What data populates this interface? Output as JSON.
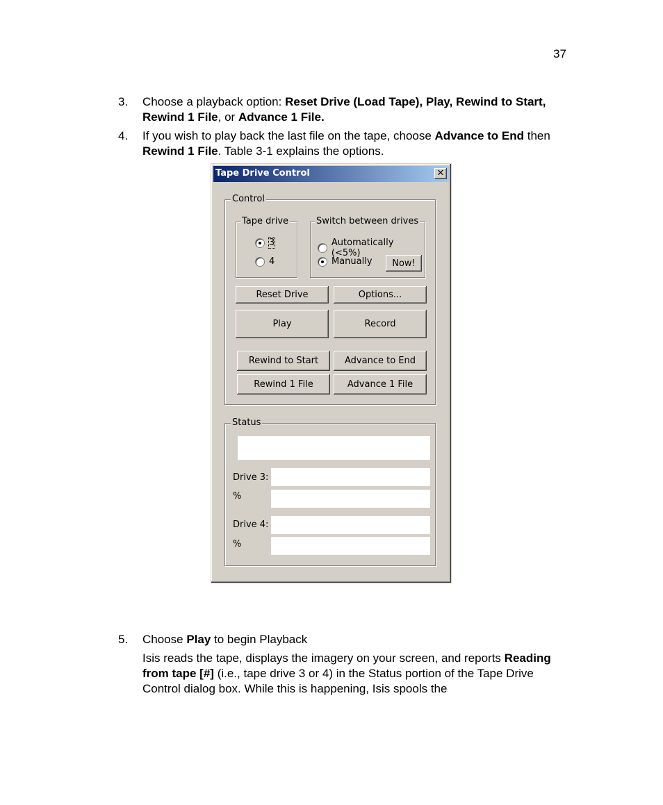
{
  "page": {
    "number": "37"
  },
  "steps": [
    {
      "num": "3.",
      "parts": [
        {
          "t": "Choose a playback option: ",
          "b": false
        },
        {
          "t": "Reset Drive (Load Tape), Play, Rewind to Start, Rewind 1 File",
          "b": true
        },
        {
          "t": ", or ",
          "b": false
        },
        {
          "t": "Advance 1 File.",
          "b": true
        }
      ]
    },
    {
      "num": "4.",
      "parts": [
        {
          "t": "If you wish to play back the last file on the tape, choose ",
          "b": false
        },
        {
          "t": "Advance to End",
          "b": true
        },
        {
          "t": " then ",
          "b": false
        },
        {
          "t": "Rewind 1 File",
          "b": true
        },
        {
          "t": ". Table 3-1 explains the options.",
          "b": false
        }
      ]
    },
    {
      "num": "5.",
      "parts": [
        {
          "t": "Choose ",
          "b": false
        },
        {
          "t": "Play",
          "b": true
        },
        {
          "t": " to begin Playback",
          "b": false
        }
      ]
    }
  ],
  "paragraph_after": {
    "parts": [
      {
        "t": "Isis reads the tape, displays the imagery on your screen, and reports ",
        "b": false
      },
      {
        "t": "Reading from tape [#]",
        "b": true
      },
      {
        "t": " (i.e., tape drive 3 or 4) in the Status portion of the Tape Drive Control dialog box. While this is happening, Isis spools the",
        "b": false
      }
    ]
  },
  "dialog": {
    "title": "Tape Drive Control",
    "close_icon": "close-icon",
    "control_group": {
      "label": "Control",
      "tape_drive": {
        "label": "Tape drive",
        "options": [
          {
            "label": "3",
            "checked": true
          },
          {
            "label": "4",
            "checked": false
          }
        ]
      },
      "switch_between_drives": {
        "label": "Switch between drives",
        "options": [
          {
            "label": "Automatically (<5%)",
            "checked": false
          },
          {
            "label": "Manually",
            "checked": true
          }
        ],
        "now_button": "Now!"
      },
      "buttons": {
        "reset_drive": "Reset Drive",
        "options": "Options...",
        "play": "Play",
        "record": "Record",
        "rewind_to_start": "Rewind to Start",
        "advance_to_end": "Advance to End",
        "rewind_1_file": "Rewind 1 File",
        "advance_1_file": "Advance 1 File"
      }
    },
    "status_group": {
      "label": "Status",
      "status_text": "",
      "drive3_label": "Drive 3:",
      "drive3_value": "",
      "drive3_pct_label": "%",
      "drive3_pct_value": "",
      "drive4_label": "Drive 4:",
      "drive4_value": "",
      "drive4_pct_label": "%",
      "drive4_pct_value": ""
    }
  }
}
